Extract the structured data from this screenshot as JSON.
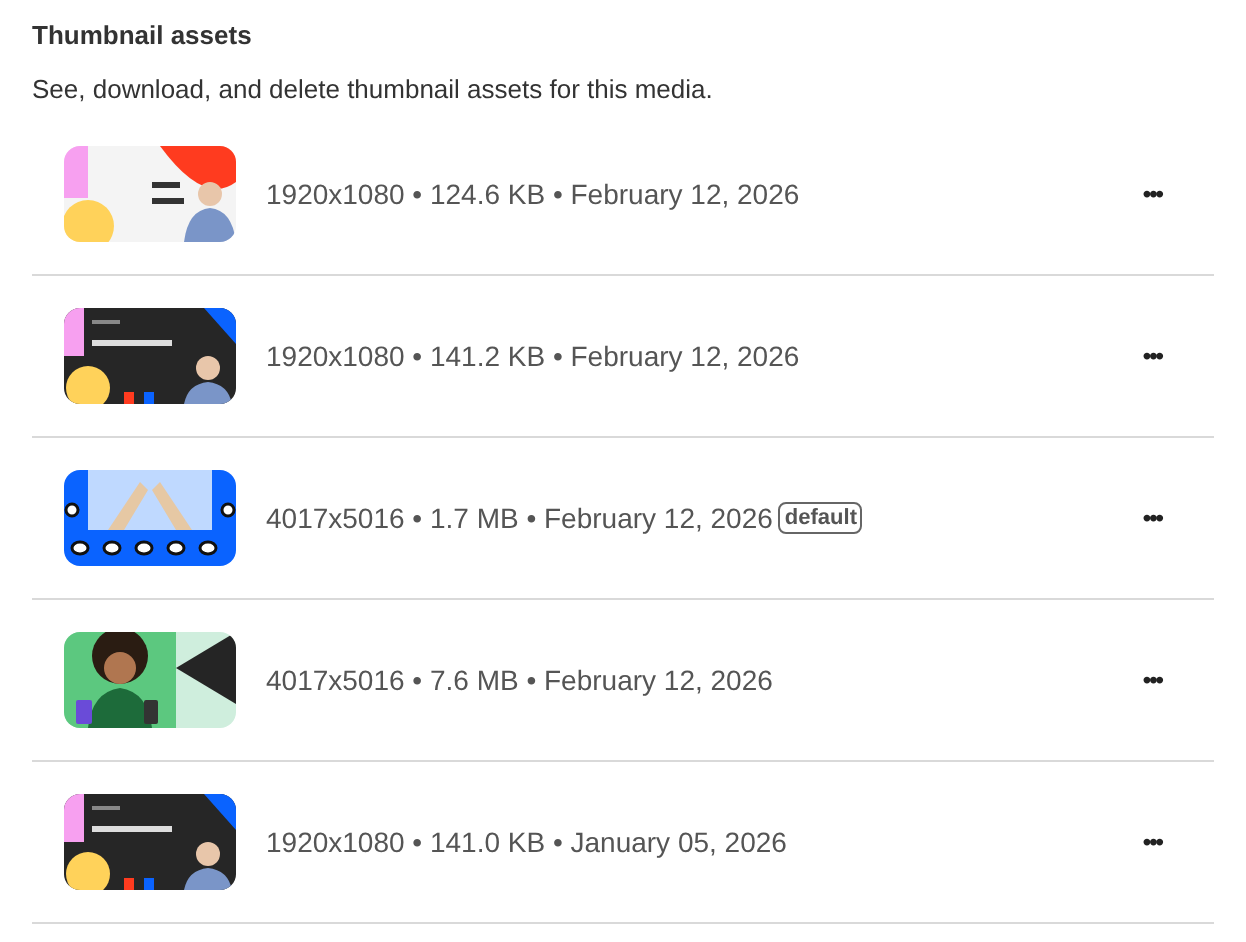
{
  "title": "Thumbnail assets",
  "description": "See, download, and delete thumbnail assets for this media.",
  "assets": [
    {
      "details": "1920x1080 • 124.6 KB • February 12, 2026",
      "more": "•••"
    },
    {
      "details": "1920x1080 • 141.2 KB • February 12, 2026",
      "more": "•••"
    },
    {
      "details": "4017x5016 • 1.7 MB • February 12, 2026",
      "badge": "default",
      "more": "•••"
    },
    {
      "details": "4017x5016 • 7.6 MB • February 12, 2026",
      "more": "•••"
    },
    {
      "details": "1920x1080 • 141.0 KB • January 05, 2026",
      "more": "•••"
    }
  ]
}
